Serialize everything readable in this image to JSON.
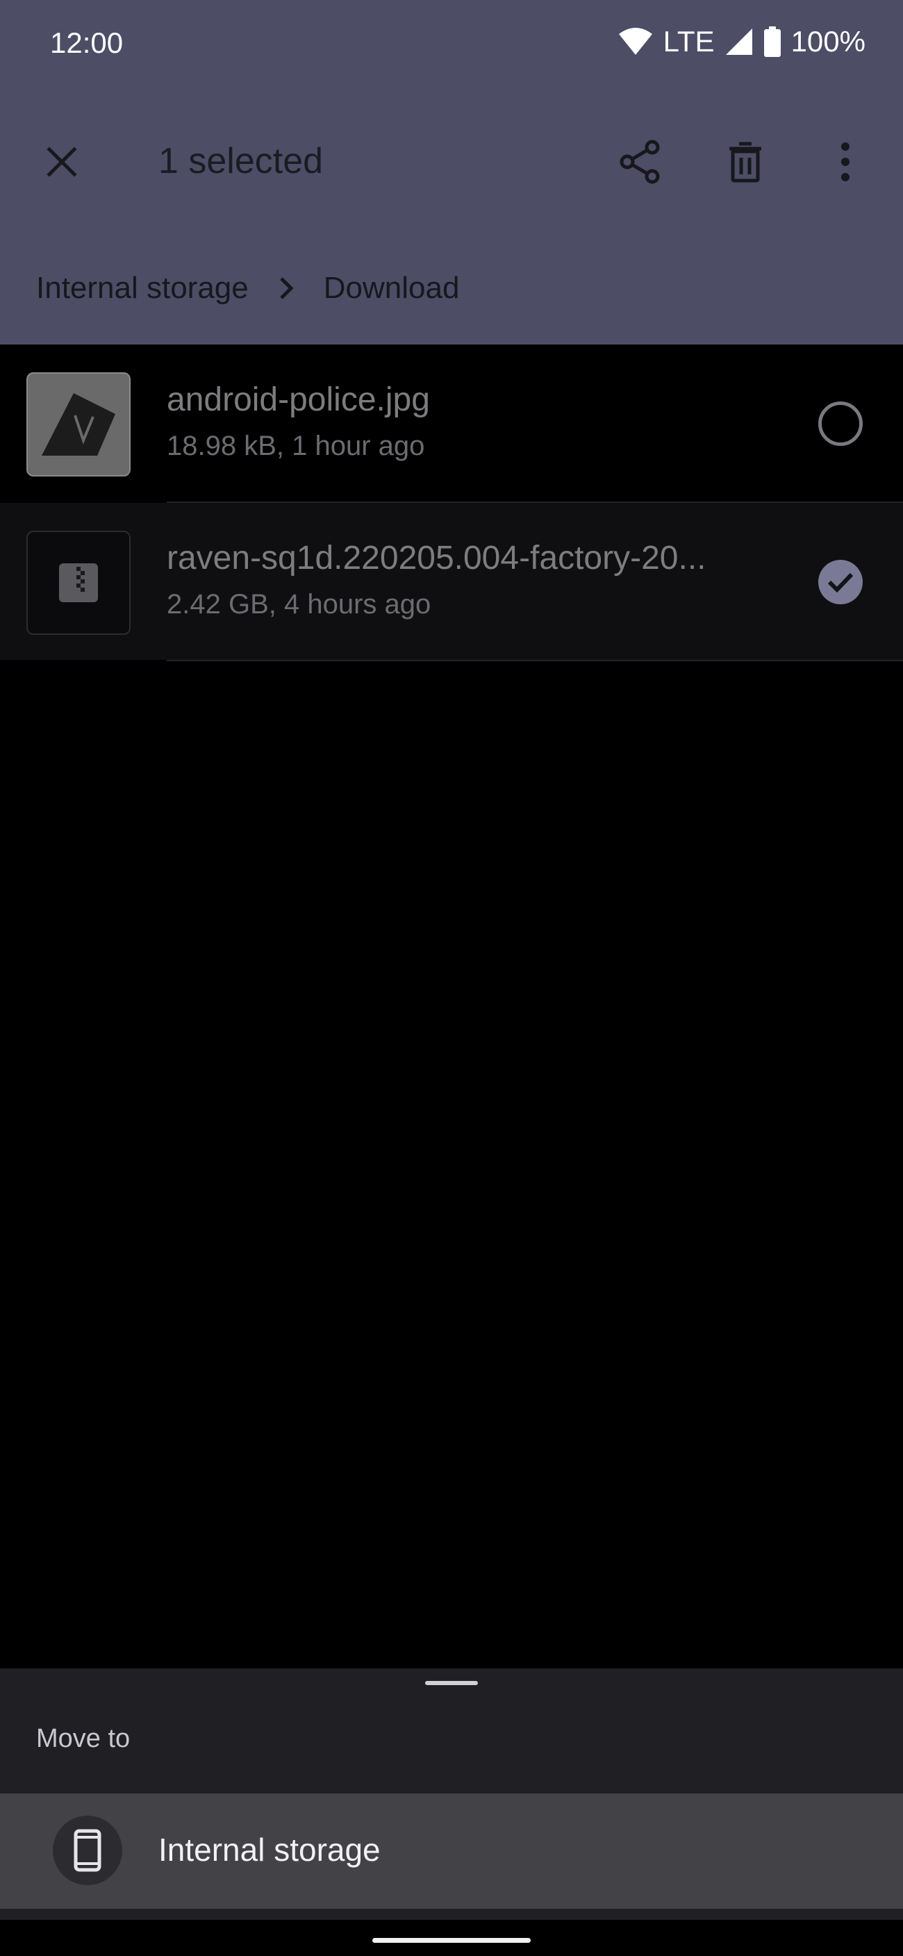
{
  "status_bar": {
    "time": "12:00",
    "network": "LTE",
    "battery": "100%"
  },
  "action_bar": {
    "title": "1 selected",
    "icons": [
      "close-icon",
      "share-icon",
      "delete-icon",
      "more-vert-icon"
    ]
  },
  "breadcrumb": {
    "root": "Internal storage",
    "current": "Download"
  },
  "files": [
    {
      "name": "android-police.jpg",
      "meta": "18.98 kB, 1 hour ago",
      "selected": false,
      "icon": "image-thumbnail"
    },
    {
      "name": "raven-sq1d.220205.004-factory-20...",
      "meta": "2.42 GB, 4 hours ago",
      "selected": true,
      "icon": "archive-icon"
    }
  ],
  "bottom_sheet": {
    "title": "Move to",
    "destination": {
      "label": "Internal storage",
      "icon": "phone-icon"
    }
  },
  "colors": {
    "topbar": "#4d4d66",
    "sheet": "#1f1f24",
    "destination": "#434347",
    "check_accent": "#7b7a96"
  }
}
